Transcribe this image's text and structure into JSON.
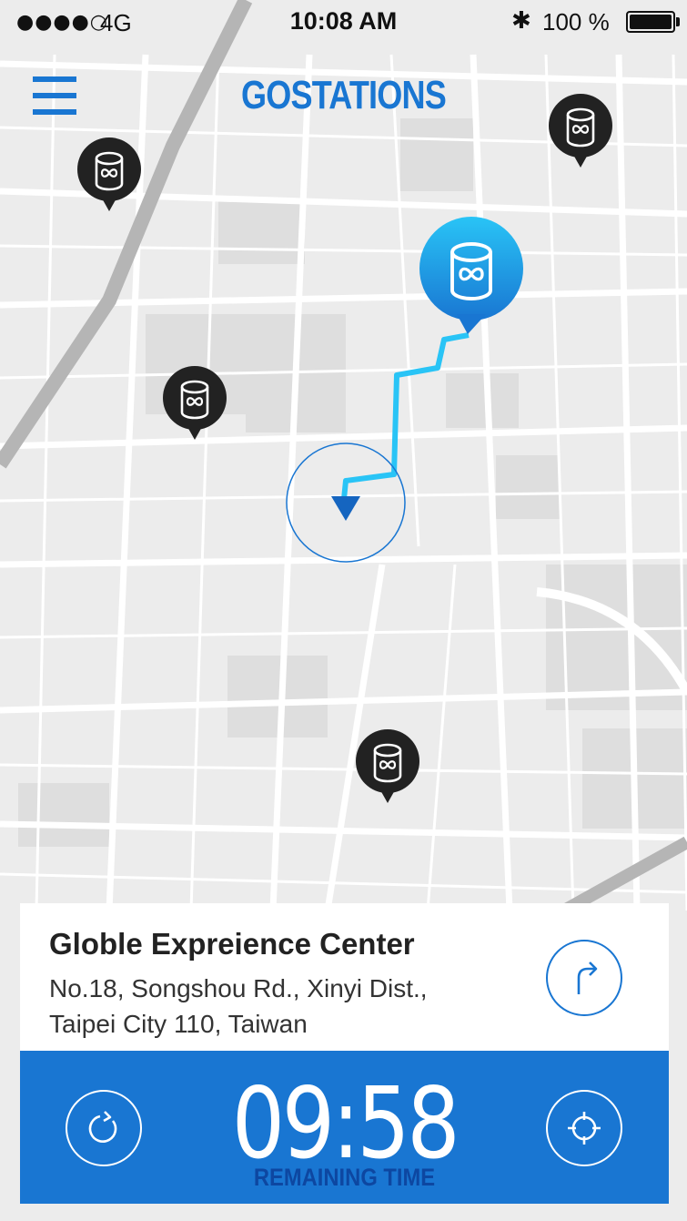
{
  "status_bar": {
    "signal": "●●●●○",
    "network": "4G",
    "time": "10:08 AM",
    "bluetooth": "✱",
    "battery": "100 %"
  },
  "header": {
    "title": "GOSTATIONS",
    "menu_icon": "hamburger-menu-icon"
  },
  "map": {
    "stations": [
      {
        "icon": "battery-station-icon",
        "selected": false
      },
      {
        "icon": "battery-station-icon",
        "selected": false
      },
      {
        "icon": "battery-station-icon",
        "selected": false
      },
      {
        "icon": "battery-station-icon",
        "selected": false
      },
      {
        "icon": "battery-station-icon",
        "selected": true
      }
    ],
    "user_location_icon": "user-heading-arrow-icon",
    "route_color": "#29c4f6"
  },
  "station_card": {
    "name": "Globle Expreience Center",
    "address_line1": "No.18, Songshou Rd., Xinyi Dist.,",
    "address_line2": "Taipei City 110, Taiwan",
    "navigate_icon": "turn-right-icon"
  },
  "timer": {
    "value": "09:58",
    "label": "REMAINING TIME",
    "refresh_icon": "refresh-icon",
    "locate_icon": "crosshair-icon"
  },
  "colors": {
    "accent": "#1976d2",
    "pin_dark": "#222222",
    "route": "#29c4f6",
    "map_bg": "#ececec"
  }
}
